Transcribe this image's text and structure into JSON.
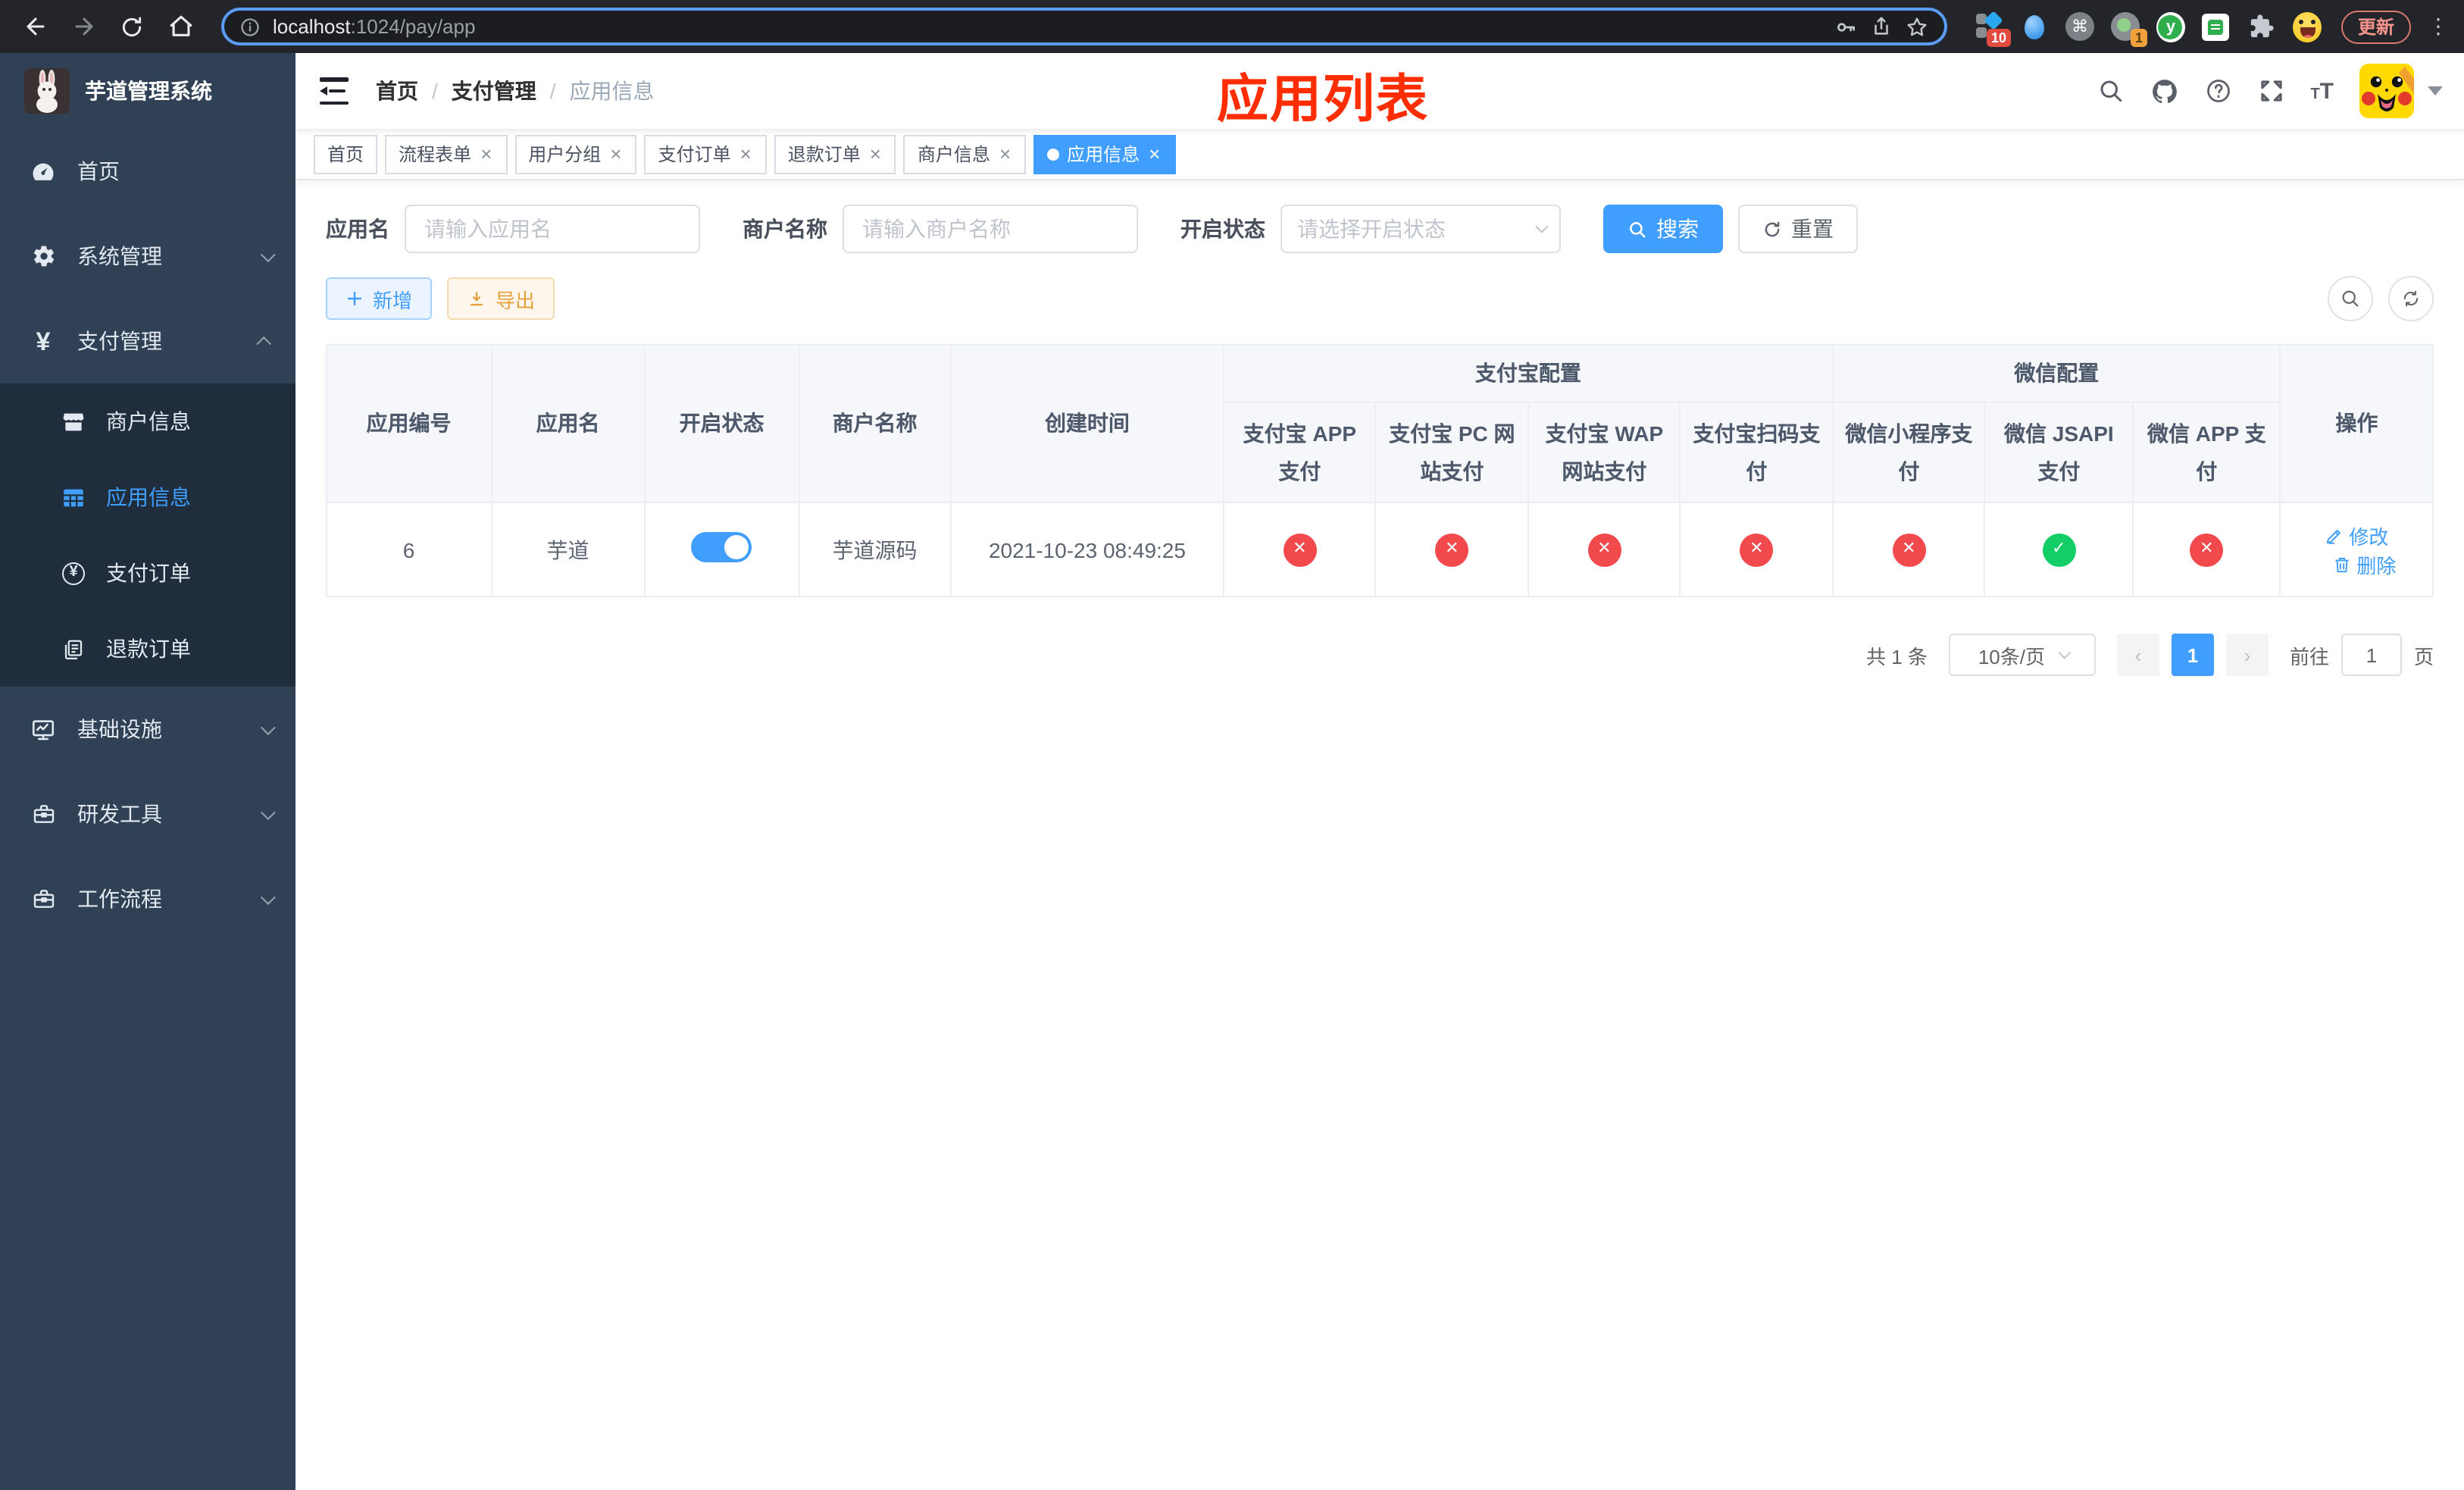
{
  "colors": {
    "accent": "#409eff",
    "success": "#13ce66",
    "danger": "#f2494d",
    "warning": "#e6a23c",
    "annotation": "#ff2d00"
  },
  "browser": {
    "url_host": "localhost",
    "url_rest": ":1024/pay/app",
    "ext_badge_1": "10",
    "ext_badge_2": "1",
    "ext_y_letter": "y",
    "cmd_glyph": "⌘",
    "update_label": "更新"
  },
  "sidebar": {
    "title": "芋道管理系统",
    "menu": [
      {
        "label": "首页",
        "icon": "dashboard-icon"
      },
      {
        "label": "系统管理",
        "icon": "gear-icon",
        "state": "collapsed"
      },
      {
        "label": "支付管理",
        "icon": "yen-icon",
        "state": "expanded",
        "children": [
          {
            "label": "商户信息",
            "icon": "store-icon"
          },
          {
            "label": "应用信息",
            "icon": "grid-icon",
            "active": true
          },
          {
            "label": "支付订单",
            "icon": "yen-circle-icon"
          },
          {
            "label": "退款订单",
            "icon": "documents-icon"
          }
        ]
      },
      {
        "label": "基础设施",
        "icon": "monitor-icon",
        "state": "collapsed"
      },
      {
        "label": "研发工具",
        "icon": "toolbox-icon",
        "state": "collapsed"
      },
      {
        "label": "工作流程",
        "icon": "briefcase-icon",
        "state": "collapsed"
      }
    ],
    "yen_glyph": "¥"
  },
  "navbar": {
    "breadcrumb": [
      "首页",
      "支付管理",
      "应用信息"
    ],
    "separator": "/",
    "annotation": "应用列表"
  },
  "tabs": [
    {
      "label": "首页"
    },
    {
      "label": "流程表单"
    },
    {
      "label": "用户分组"
    },
    {
      "label": "支付订单"
    },
    {
      "label": "退款订单"
    },
    {
      "label": "商户信息"
    },
    {
      "label": "应用信息",
      "active": true
    }
  ],
  "filters": {
    "app_name_label": "应用名",
    "app_name_placeholder": "请输入应用名",
    "merchant_label": "商户名称",
    "merchant_placeholder": "请输入商户名称",
    "status_label": "开启状态",
    "status_placeholder": "请选择开启状态",
    "search_label": "搜索",
    "reset_label": "重置"
  },
  "toolbar": {
    "add_label": "新增",
    "export_label": "导出"
  },
  "table": {
    "col_app_id": "应用编号",
    "col_app_name": "应用名",
    "col_status": "开启状态",
    "col_merchant": "商户名称",
    "col_created": "创建时间",
    "group_alipay": "支付宝配置",
    "group_wechat": "微信配置",
    "col_alipay_app": "支付宝 APP 支付",
    "col_alipay_pc": "支付宝 PC 网站支付",
    "col_alipay_wap": "支付宝 WAP 网站支付",
    "col_alipay_qr": "支付宝扫码支付",
    "col_wx_mini": "微信小程序支付",
    "col_wx_jsapi": "微信 JSAPI 支付",
    "col_wx_app": "微信 APP 支付",
    "col_op": "操作",
    "row": {
      "id": "6",
      "name": "芋道",
      "enabled": "on",
      "merchant": "芋道源码",
      "created": "2021-10-23 08:49:25",
      "statuses": [
        "fail",
        "fail",
        "fail",
        "fail",
        "fail",
        "success",
        "fail"
      ],
      "edit_label": "修改",
      "delete_label": "删除"
    }
  },
  "pagination": {
    "total_label": "共 1 条",
    "page_size_label": "10条/页",
    "page": "1",
    "goto_label": "前往",
    "goto_value": "1",
    "goto_suffix": "页"
  }
}
